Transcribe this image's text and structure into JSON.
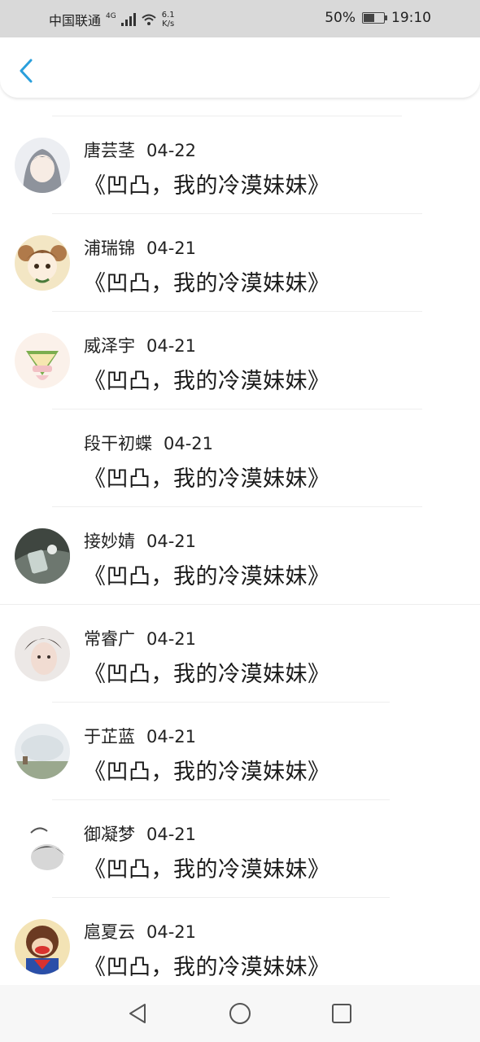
{
  "status_bar": {
    "carrier": "中国联通",
    "network": "4G",
    "speed_value": "6.1",
    "speed_unit": "K/s",
    "battery_percent": "50%",
    "time": "19:10"
  },
  "header": {
    "back_icon": "chevron-left-icon"
  },
  "comments": [
    {
      "name": "唐芸茎",
      "date": "04-22",
      "title": "《凹凸，我的冷漠妹妹》"
    },
    {
      "name": "浦瑞锦",
      "date": "04-21",
      "title": "《凹凸，我的冷漠妹妹》"
    },
    {
      "name": "威泽宇",
      "date": "04-21",
      "title": "《凹凸，我的冷漠妹妹》"
    },
    {
      "name": "段干初蝶",
      "date": "04-21",
      "title": "《凹凸，我的冷漠妹妹》"
    },
    {
      "name": "接妙婧",
      "date": "04-21",
      "title": "《凹凸，我的冷漠妹妹》"
    },
    {
      "name": "常睿广",
      "date": "04-21",
      "title": "《凹凸，我的冷漠妹妹》"
    },
    {
      "name": "于芷蓝",
      "date": "04-21",
      "title": "《凹凸，我的冷漠妹妹》"
    },
    {
      "name": "御凝梦",
      "date": "04-21",
      "title": "《凹凸，我的冷漠妹妹》"
    },
    {
      "name": "扈夏云",
      "date": "04-21",
      "title": "《凹凸，我的冷漠妹妹》"
    }
  ],
  "nav_bar": {
    "back_icon": "triangle-back-icon",
    "home_icon": "circle-home-icon",
    "recents_icon": "square-recents-icon"
  },
  "colors": {
    "accent": "#2a9fdc",
    "status_bar_bg": "#d9d9d9",
    "nav_bar_bg": "#f7f7f7"
  }
}
